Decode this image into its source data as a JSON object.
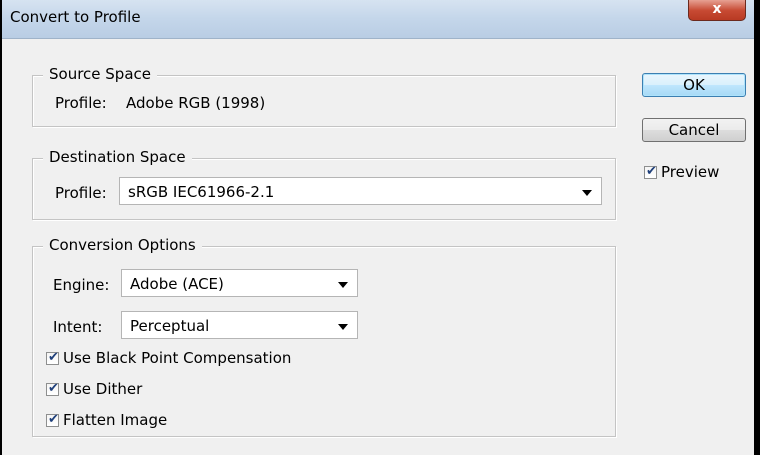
{
  "window": {
    "title": "Convert to Profile",
    "close_glyph": "x"
  },
  "source_space": {
    "legend": "Source Space",
    "profile_label": "Profile:",
    "profile_value": "Adobe RGB (1998)"
  },
  "destination_space": {
    "legend": "Destination Space",
    "profile_label": "Profile:",
    "profile_value": "sRGB IEC61966-2.1"
  },
  "conversion_options": {
    "legend": "Conversion Options",
    "engine_label": "Engine:",
    "engine_value": "Adobe (ACE)",
    "intent_label": "Intent:",
    "intent_value": "Perceptual",
    "checkboxes": [
      {
        "label": "Use Black Point Compensation",
        "checked": true
      },
      {
        "label": "Use Dither",
        "checked": true
      },
      {
        "label": "Flatten Image",
        "checked": true
      }
    ]
  },
  "buttons": {
    "ok": "OK",
    "cancel": "Cancel"
  },
  "preview": {
    "label": "Preview",
    "checked": true
  },
  "check_glyph": "✔"
}
